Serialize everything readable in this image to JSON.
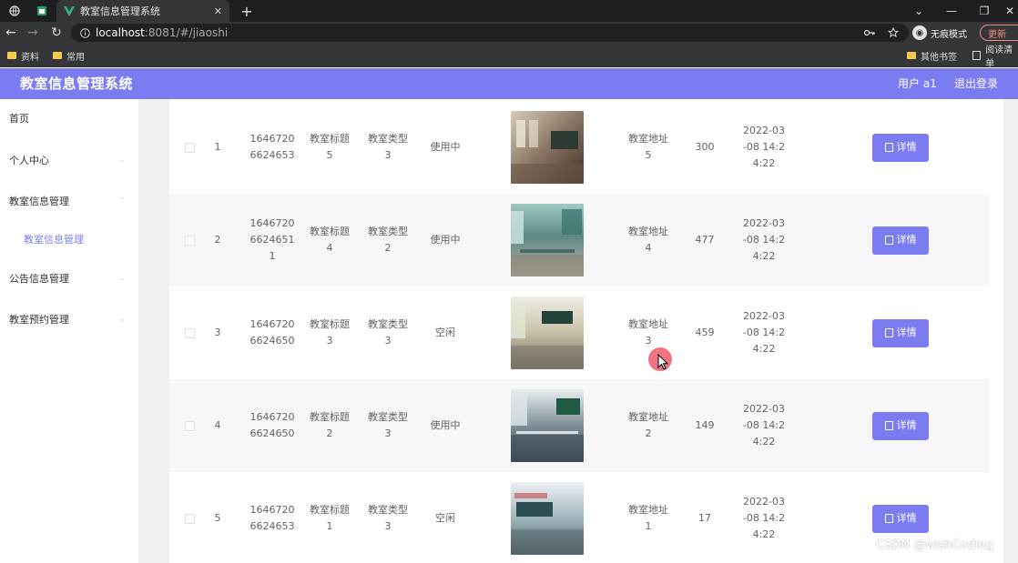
{
  "browser": {
    "tab_title": "教室信息管理系统",
    "tab_close": "✕",
    "new_tab": "+",
    "url_host": "localhost",
    "url_path": ":8081/#/jiaoshi",
    "incognito_label": "无痕模式",
    "update_label": "更新",
    "bookmarks": [
      "资料",
      "常用"
    ],
    "bookmarks_right": [
      "其他书签",
      "阅读清单"
    ],
    "window_controls": [
      "⌄",
      "—",
      "❐",
      "✕"
    ]
  },
  "header": {
    "title": "教室信息管理系统",
    "user": "用户 a1",
    "logout": "退出登录"
  },
  "sidebar": {
    "items": [
      {
        "label": "首页"
      },
      {
        "label": "个人中心"
      },
      {
        "label": "教室信息管理"
      },
      {
        "label": "教室信息管理"
      },
      {
        "label": "公告信息管理"
      },
      {
        "label": "教室预约管理"
      }
    ]
  },
  "table": {
    "detail_label": "详情",
    "rows": [
      {
        "index": "1",
        "id": "1646720\n6624653",
        "title": "教室标题\n5",
        "type": "教室类型\n3",
        "status": "使用中",
        "address": "教室地址\n5",
        "count": "300",
        "date": "2022-03\n-08 14:2\n4:22"
      },
      {
        "index": "2",
        "id": "1646720\n6624651\n1",
        "title": "教室标题\n4",
        "type": "教室类型\n2",
        "status": "使用中",
        "address": "教室地址\n4",
        "count": "477",
        "date": "2022-03\n-08 14:2\n4:22"
      },
      {
        "index": "3",
        "id": "1646720\n6624650",
        "title": "教室标题\n3",
        "type": "教室类型\n3",
        "status": "空闲",
        "address": "教室地址\n3",
        "count": "459",
        "date": "2022-03\n-08 14:2\n4:22"
      },
      {
        "index": "4",
        "id": "1646720\n6624650",
        "title": "教室标题\n2",
        "type": "教室类型\n3",
        "status": "使用中",
        "address": "教室地址\n2",
        "count": "149",
        "date": "2022-03\n-08 14:2\n4:22"
      },
      {
        "index": "5",
        "id": "1646720\n6624653",
        "title": "教室标题\n1",
        "type": "教室类型\n3",
        "status": "空闲",
        "address": "教室地址\n1",
        "count": "17",
        "date": "2022-03\n-08 14:2\n4:22"
      }
    ]
  },
  "watermark": "CSDN @wishCoding",
  "colors": {
    "accent": "#7c7cf2",
    "header_bg": "#7c7cf2",
    "sidebar_active": "#7c7cf2"
  }
}
